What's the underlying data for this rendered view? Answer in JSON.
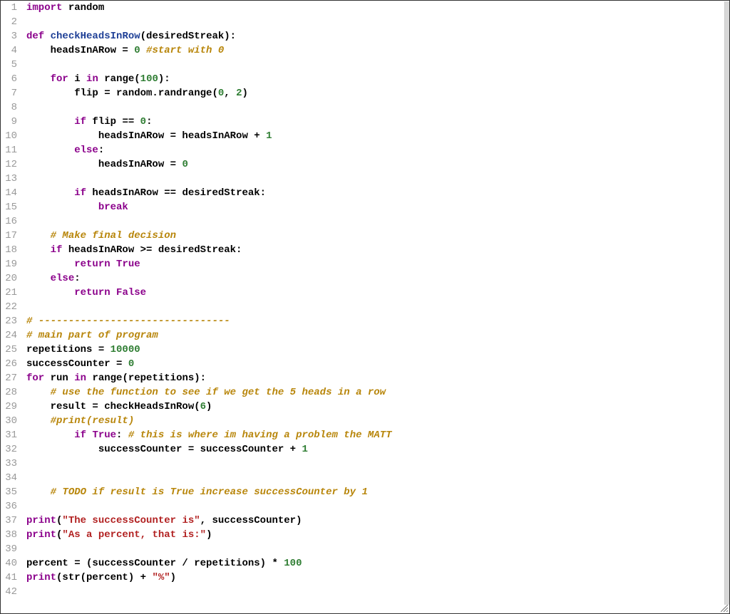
{
  "lines": [
    {
      "n": 1,
      "tokens": [
        [
          "kw",
          "import"
        ],
        [
          "",
          " random"
        ]
      ]
    },
    {
      "n": 2,
      "tokens": []
    },
    {
      "n": 3,
      "tokens": [
        [
          "kw",
          "def"
        ],
        [
          "",
          " "
        ],
        [
          "fndef",
          "checkHeadsInRow"
        ],
        [
          "",
          "(desiredStreak):"
        ]
      ]
    },
    {
      "n": 4,
      "tokens": [
        [
          "",
          "    headsInARow = "
        ],
        [
          "num",
          "0"
        ],
        [
          "",
          " "
        ],
        [
          "cm",
          "#start with 0"
        ]
      ]
    },
    {
      "n": 5,
      "tokens": []
    },
    {
      "n": 6,
      "tokens": [
        [
          "",
          "    "
        ],
        [
          "kw",
          "for"
        ],
        [
          "",
          " i "
        ],
        [
          "kw",
          "in"
        ],
        [
          "",
          " range("
        ],
        [
          "num",
          "100"
        ],
        [
          "",
          "):"
        ]
      ]
    },
    {
      "n": 7,
      "tokens": [
        [
          "",
          "        flip = random.randrange("
        ],
        [
          "num",
          "0"
        ],
        [
          "",
          ", "
        ],
        [
          "num",
          "2"
        ],
        [
          "",
          ")"
        ]
      ]
    },
    {
      "n": 8,
      "tokens": []
    },
    {
      "n": 9,
      "tokens": [
        [
          "",
          "        "
        ],
        [
          "kw",
          "if"
        ],
        [
          "",
          " flip == "
        ],
        [
          "num",
          "0"
        ],
        [
          "",
          ":"
        ]
      ]
    },
    {
      "n": 10,
      "tokens": [
        [
          "",
          "            headsInARow = headsInARow + "
        ],
        [
          "num",
          "1"
        ]
      ]
    },
    {
      "n": 11,
      "tokens": [
        [
          "",
          "        "
        ],
        [
          "kw",
          "else"
        ],
        [
          "",
          ":"
        ]
      ]
    },
    {
      "n": 12,
      "tokens": [
        [
          "",
          "            headsInARow = "
        ],
        [
          "num",
          "0"
        ]
      ]
    },
    {
      "n": 13,
      "tokens": []
    },
    {
      "n": 14,
      "tokens": [
        [
          "",
          "        "
        ],
        [
          "kw",
          "if"
        ],
        [
          "",
          " headsInARow == desiredStreak:"
        ]
      ]
    },
    {
      "n": 15,
      "tokens": [
        [
          "",
          "            "
        ],
        [
          "kw",
          "break"
        ]
      ]
    },
    {
      "n": 16,
      "tokens": []
    },
    {
      "n": 17,
      "tokens": [
        [
          "",
          "    "
        ],
        [
          "cm",
          "# Make final decision"
        ]
      ]
    },
    {
      "n": 18,
      "tokens": [
        [
          "",
          "    "
        ],
        [
          "kw",
          "if"
        ],
        [
          "",
          " headsInARow >= desiredStreak:"
        ]
      ]
    },
    {
      "n": 19,
      "tokens": [
        [
          "",
          "        "
        ],
        [
          "kw",
          "return"
        ],
        [
          "",
          " "
        ],
        [
          "kw",
          "True"
        ]
      ]
    },
    {
      "n": 20,
      "tokens": [
        [
          "",
          "    "
        ],
        [
          "kw",
          "else"
        ],
        [
          "",
          ":"
        ]
      ]
    },
    {
      "n": 21,
      "tokens": [
        [
          "",
          "        "
        ],
        [
          "kw",
          "return"
        ],
        [
          "",
          " "
        ],
        [
          "kw",
          "False"
        ]
      ]
    },
    {
      "n": 22,
      "tokens": []
    },
    {
      "n": 23,
      "tokens": [
        [
          "cm",
          "# --------------------------------"
        ]
      ]
    },
    {
      "n": 24,
      "tokens": [
        [
          "cm",
          "# main part of program"
        ]
      ]
    },
    {
      "n": 25,
      "tokens": [
        [
          "",
          "repetitions = "
        ],
        [
          "num",
          "10000"
        ]
      ]
    },
    {
      "n": 26,
      "tokens": [
        [
          "",
          "successCounter = "
        ],
        [
          "num",
          "0"
        ]
      ]
    },
    {
      "n": 27,
      "tokens": [
        [
          "kw",
          "for"
        ],
        [
          "",
          " run "
        ],
        [
          "kw",
          "in"
        ],
        [
          "",
          " range(repetitions):"
        ]
      ]
    },
    {
      "n": 28,
      "tokens": [
        [
          "",
          "    "
        ],
        [
          "cm",
          "# use the function to see if we get the 5 heads in a row"
        ]
      ]
    },
    {
      "n": 29,
      "tokens": [
        [
          "",
          "    result = checkHeadsInRow("
        ],
        [
          "num",
          "6"
        ],
        [
          "",
          ")"
        ]
      ]
    },
    {
      "n": 30,
      "tokens": [
        [
          "",
          "    "
        ],
        [
          "cm",
          "#print(result)"
        ]
      ]
    },
    {
      "n": 31,
      "tokens": [
        [
          "",
          "        "
        ],
        [
          "kw",
          "if"
        ],
        [
          "",
          " "
        ],
        [
          "kw",
          "True"
        ],
        [
          "",
          ": "
        ],
        [
          "cm",
          "# this is where im having a problem the MATT"
        ]
      ]
    },
    {
      "n": 32,
      "tokens": [
        [
          "",
          "            successCounter = successCounter + "
        ],
        [
          "num",
          "1"
        ]
      ]
    },
    {
      "n": 33,
      "tokens": []
    },
    {
      "n": 34,
      "tokens": []
    },
    {
      "n": 35,
      "tokens": [
        [
          "",
          "    "
        ],
        [
          "cm",
          "# TODO if result is True increase successCounter by 1"
        ]
      ]
    },
    {
      "n": 36,
      "tokens": []
    },
    {
      "n": 37,
      "tokens": [
        [
          "kw",
          "print"
        ],
        [
          "",
          "("
        ],
        [
          "str",
          "\"The successCounter is\""
        ],
        [
          "",
          ", successCounter)"
        ]
      ]
    },
    {
      "n": 38,
      "tokens": [
        [
          "kw",
          "print"
        ],
        [
          "",
          "("
        ],
        [
          "str",
          "\"As a percent, that is:\""
        ],
        [
          "",
          ")"
        ]
      ]
    },
    {
      "n": 39,
      "tokens": []
    },
    {
      "n": 40,
      "tokens": [
        [
          "",
          "percent = (successCounter / repetitions) * "
        ],
        [
          "num",
          "100"
        ]
      ]
    },
    {
      "n": 41,
      "tokens": [
        [
          "kw",
          "print"
        ],
        [
          "",
          "(str(percent) + "
        ],
        [
          "str",
          "\"%\""
        ],
        [
          "",
          ")"
        ]
      ]
    },
    {
      "n": 42,
      "tokens": []
    }
  ]
}
